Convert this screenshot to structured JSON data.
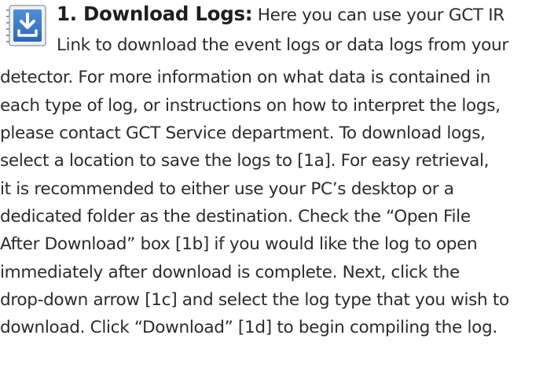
{
  "section": {
    "icon": "download-arrow-icon",
    "heading": "1. Download Logs:",
    "lines": [
      "Here you can use your GCT IR",
      "Link to download the event logs or data logs from your",
      "detector. For more information on what data is contained in",
      "each type of log, or instructions on how to interpret the logs,",
      "please contact GCT Service department. To download logs,",
      "select a location to save the logs to [1a]. For easy retrieval,",
      "it is recommended to either use your PC’s desktop or a",
      "dedicated folder as the destination. Check the “Open File",
      "After Download” box [1b] if you would like the log to open",
      "immediately after download is complete. Next, click the",
      "drop-down arrow [1c] and select the log type that you wish to",
      "download. Click “Download” [1d] to begin compiling the log."
    ]
  },
  "colors": {
    "text": "#2b2b2b",
    "icon_blue": "#3a78c8",
    "icon_border": "#9aa4ae"
  }
}
